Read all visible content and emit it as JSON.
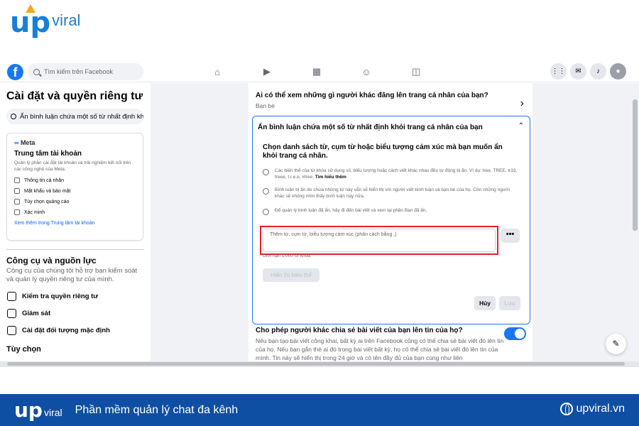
{
  "brand": {
    "logo_main": "up",
    "logo_sub": "viral"
  },
  "fb": {
    "search_placeholder": "Tìm kiếm trên Facebook",
    "nav_icons": [
      "home-icon",
      "video-icon",
      "marketplace-icon",
      "groups-icon",
      "gaming-icon"
    ],
    "right_icons": [
      "menu-grid-icon",
      "messenger-icon",
      "notifications-icon",
      "profile-avatar"
    ]
  },
  "sidebar": {
    "title": "Cài đặt và quyền riêng tư",
    "search_value": "Ẩn bình luận chứa một số từ nhất định khỏi",
    "meta_brand": "Meta",
    "account_center": {
      "title": "Trung tâm tài khoản",
      "desc": "Quản lý phần cài đặt tài khoản và trải nghiệm kết nối trên các công nghệ của Meta.",
      "items": [
        "Thông tin cá nhân",
        "Mật khẩu và bảo mật",
        "Tùy chọn quảng cáo",
        "Xác minh"
      ],
      "link": "Xem thêm trong Trung tâm tài khoản"
    },
    "tools": {
      "title": "Công cụ và nguồn lực",
      "desc": "Công cụ của chúng tôi hỗ trợ bạn kiểm soát và quản lý quyền riêng tư của mình.",
      "items": [
        "Kiểm tra quyền riêng tư",
        "Giám sát",
        "Cài đặt đối tượng mặc định"
      ]
    },
    "options_title": "Tùy chọn"
  },
  "main": {
    "row1_title": "Ai có thể xem những gì người khác đăng lên trang cá nhân của bạn?",
    "row1_value": "Bạn bè",
    "box_title": "Ẩn bình luận chứa một số từ nhất định khỏi trang cá nhân của bạn",
    "box_question": "Chọn danh sách từ, cụm từ hoặc biểu tượng cảm xúc mà bạn muốn ẩn khỏi trang cá nhân.",
    "info1": "Các biến thể của từ khóa sử dụng số, biểu tượng hoặc cách viết khác nhau đều tự động bị ẩn. Ví dụ: tree, TREE, tr33, treee, t.r.e.e, #tree.",
    "info1_link": "Tìm hiểu thêm",
    "info2": "Bình luận bị ẩn do chứa những từ này vẫn sẽ hiển thị với người viết bình luận và bạn bè của họ. Còn những người khác sẽ không nhìn thấy bình luận này nữa.",
    "info3": "Để quản lý bình luận đã ẩn, hãy đi đến bài viết và xem lại phần Bạn đã ẩn.",
    "input_placeholder": "Thêm từ, cụm từ, biểu tượng cảm xúc (phân cách bằng ,)",
    "more_label": "•••",
    "limit_text": "Giới hạn 1.000 từ khóa.",
    "show_btn": "Hiển thị biến thể",
    "cancel_btn": "Hủy",
    "save_btn": "Lưu",
    "row3_title": "Cho phép người khác chia sẻ bài viết của bạn lên tin của họ?",
    "row3_desc": "Nếu bạn tạo bài viết công khai, bất kỳ ai trên Facebook cũng có thể chia sẻ bài viết đó lên tin của họ. Nếu bạn gắn thẻ ai đó trong bài viết bất kỳ, họ có thể chia sẻ bài viết đó lên tin của mình. Tin này sẽ hiển thị trong 24 giờ và có tên đầy đủ của bạn cùng như liên",
    "toggle_on": true
  },
  "footer": {
    "logo_main": "up",
    "logo_sub": "viral",
    "tagline": "Phần mềm quản lý chat đa kênh",
    "site": "upviral.vn"
  }
}
